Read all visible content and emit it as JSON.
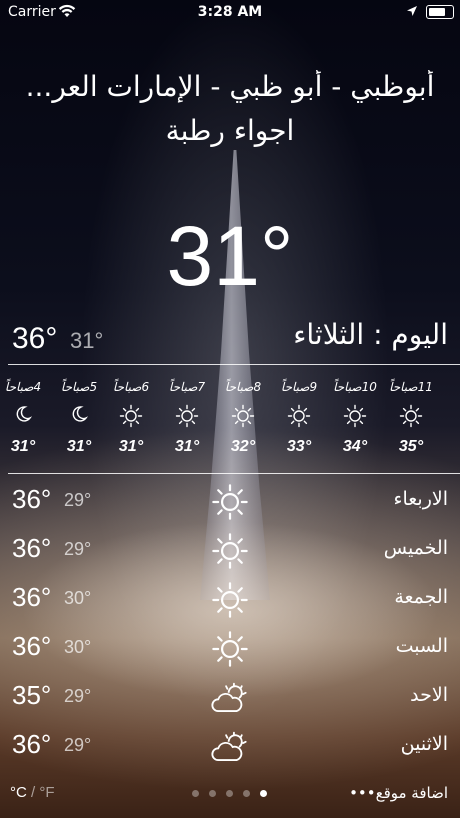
{
  "status_bar": {
    "carrier": "Carrier",
    "time": "3:28 AM"
  },
  "header": {
    "location": "أبوظبي - أبو ظبي - الإمارات العر...",
    "condition": "اجواء رطبة",
    "current_temp": "31°"
  },
  "today": {
    "label": "اليوم : الثلاثاء",
    "high": "36°",
    "low": "31°"
  },
  "hourly": [
    {
      "label": "11صباحاً",
      "icon": "sun-icon",
      "temp": "35°"
    },
    {
      "label": "10صباحاً",
      "icon": "sun-icon",
      "temp": "34°"
    },
    {
      "label": "9صباحاً",
      "icon": "sun-icon",
      "temp": "33°"
    },
    {
      "label": "8صباحاً",
      "icon": "sun-icon",
      "temp": "32°"
    },
    {
      "label": "7صباحاً",
      "icon": "sun-icon",
      "temp": "31°"
    },
    {
      "label": "6صباحاً",
      "icon": "sun-icon",
      "temp": "31°"
    },
    {
      "label": "5صباحاً",
      "icon": "moon-icon",
      "temp": "31°"
    },
    {
      "label": "4صباحاً",
      "icon": "moon-icon",
      "temp": "31°"
    }
  ],
  "daily": [
    {
      "day": "الاربعاء",
      "icon": "sun-icon",
      "high": "36°",
      "low": "29°"
    },
    {
      "day": "الخميس",
      "icon": "sun-icon",
      "high": "36°",
      "low": "29°"
    },
    {
      "day": "الجمعة",
      "icon": "sun-icon",
      "high": "36°",
      "low": "30°"
    },
    {
      "day": "السبت",
      "icon": "sun-icon",
      "high": "36°",
      "low": "30°"
    },
    {
      "day": "الاحد",
      "icon": "partly-cloudy-icon",
      "high": "35°",
      "low": "29°"
    },
    {
      "day": "الاثنين",
      "icon": "partly-cloudy-icon",
      "high": "36°",
      "low": "29°"
    }
  ],
  "footer": {
    "unit_c": "°C",
    "unit_sep": " / ",
    "unit_f": "°F",
    "add_location": "اضافة موقع•••",
    "page_count": 5,
    "active_page": 5
  }
}
